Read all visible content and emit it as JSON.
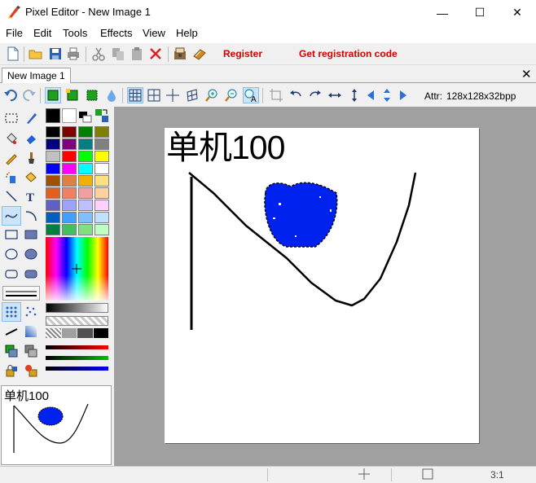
{
  "window": {
    "title": "Pixel Editor - New Image 1",
    "minimize_glyph": "—",
    "maximize_glyph": "☐",
    "close_glyph": "✕"
  },
  "menu": [
    "File",
    "Edit",
    "Tools",
    "Effects",
    "View",
    "Help"
  ],
  "toolbar": {
    "icons": [
      "new-icon",
      "open-icon",
      "save-icon",
      "print-icon",
      "cut-icon",
      "copy-icon",
      "paste-icon",
      "delete-icon",
      "scan-icon",
      "register-book-icon"
    ],
    "register_label": "Register",
    "get_code_label": "Get registration code",
    "link_color": "#d40000"
  },
  "tabs": {
    "active_label": "New Image 1",
    "close_glyph": "✕"
  },
  "toolbar2": {
    "icons": [
      "undo-icon",
      "redo-icon",
      "layer-icon",
      "layer-add-icon",
      "layer-select-icon",
      "drop-icon",
      "grid-icon",
      "grid-large-icon",
      "crosshair-icon",
      "perspective-grid-icon",
      "zoom-in-icon",
      "zoom-out-icon",
      "zoom-text-icon",
      "crop-icon",
      "rotate-left-icon",
      "rotate-right-icon",
      "flip-horizontal-icon",
      "flip-vertical-icon",
      "move-left-icon",
      "move-all-icon",
      "move-right-icon"
    ],
    "attr_label": "Attr:",
    "attr_value": "128x128x32bpp"
  },
  "tools": [
    "rect-select-icon",
    "pen-icon",
    "bucket-fill-icon",
    "eraser-icon",
    "pencil-icon",
    "brush-icon",
    "spray-icon",
    "fill-pattern-icon",
    "line-icon",
    "text-icon",
    "curve-icon",
    "arc-icon",
    "rectangle-icon",
    "filled-rectangle-icon",
    "ellipse-icon",
    "filled-ellipse-icon",
    "rounded-rect-icon",
    "filled-rounded-rect-icon"
  ],
  "palette": {
    "primary": "#000000",
    "secondary": "#ffffff",
    "swatches": [
      [
        "#000000",
        "#800000",
        "#008000",
        "#808000"
      ],
      [
        "#000080",
        "#800080",
        "#008080",
        "#808080"
      ],
      [
        "#c0c0c0",
        "#ff0000",
        "#00ff00",
        "#ffff00"
      ],
      [
        "#0000ff",
        "#ff00ff",
        "#00ffff",
        "#ffffff"
      ],
      [
        "#a05000",
        "#e08040",
        "#f0b000",
        "#ffe080"
      ],
      [
        "#e06020",
        "#f08060",
        "#f0a0a0",
        "#ffd0a0"
      ],
      [
        "#6060c0",
        "#a0a0ff",
        "#c0c0ff",
        "#ffd0ff"
      ],
      [
        "#0060c0",
        "#40a0ff",
        "#80c0ff",
        "#c0e0ff"
      ],
      [
        "#008040",
        "#40c060",
        "#80e080",
        "#c0ffc0"
      ]
    ]
  },
  "canvas": {
    "text": "单机100",
    "heart_color": "#0022ee"
  },
  "navigator": {
    "text": "单机100"
  },
  "status": {
    "zoom": "3:1"
  }
}
